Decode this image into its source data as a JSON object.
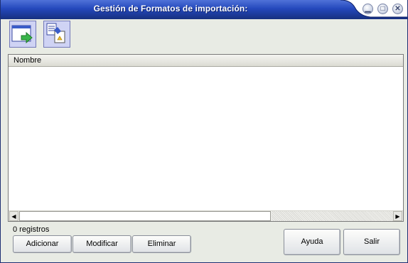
{
  "window": {
    "title": "Gestión de Formatos de importación:",
    "controls": {
      "minimize": "minimize-icon",
      "maximize": "maximize-icon",
      "close": "close-icon"
    },
    "colors": {
      "titlebar": "#2448bc",
      "titlebar_dark": "#17307f",
      "body": "#e8ebe4",
      "tool_button": "#cfd3f4"
    }
  },
  "toolbar": {
    "buttons": [
      {
        "icon": "window-export-arrow-icon"
      },
      {
        "icon": "document-edit-icon"
      }
    ]
  },
  "list": {
    "columns": [
      "Nombre"
    ],
    "rows": []
  },
  "status": {
    "records": "0 registros"
  },
  "actions": {
    "add": "Adicionar",
    "modify": "Modificar",
    "delete": "Eliminar",
    "help": "Ayuda",
    "exit": "Salir"
  }
}
